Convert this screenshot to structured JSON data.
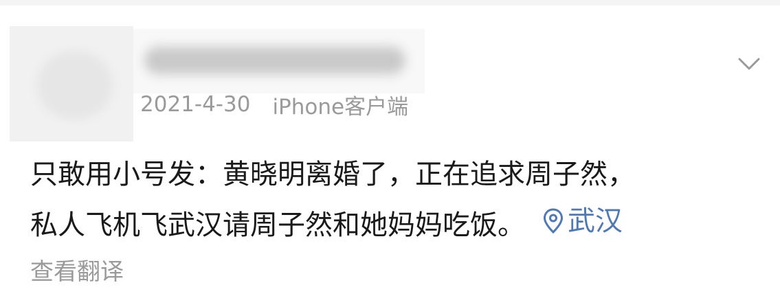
{
  "post": {
    "date": "2021-4-30",
    "client": "iPhone客户端",
    "text_line1": "只敢用小号发：黄晓明离婚了，正在追求周子然，",
    "text_line2": "私人飞机飞武汉请周子然和她妈妈吃饭。",
    "location": "武汉",
    "translate_label": "查看翻译"
  },
  "icons": {
    "more": "chevron-down-icon",
    "location": "location-pin-icon"
  },
  "colors": {
    "meta_text": "#9a9a9a",
    "body_text": "#1a1a1a",
    "location_link": "#4f79b5"
  }
}
